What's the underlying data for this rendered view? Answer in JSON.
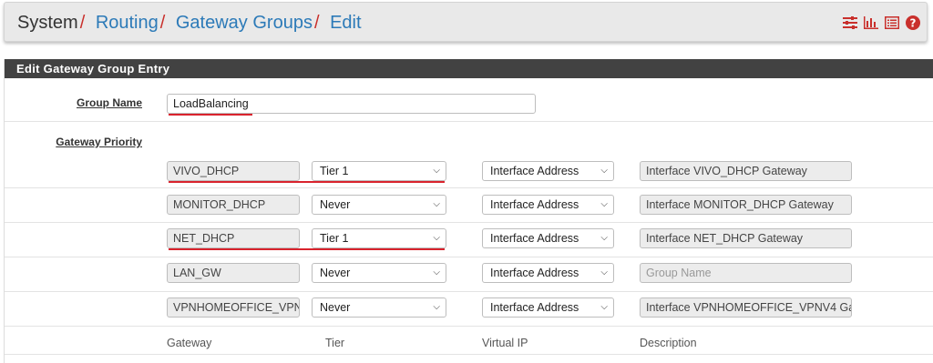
{
  "breadcrumb": {
    "root": "System",
    "items": [
      "Routing",
      "Gateway Groups",
      "Edit"
    ],
    "separator": "/"
  },
  "toolbar": {
    "icons": [
      "sliders-icon",
      "bar-chart-icon",
      "list-icon",
      "help-icon"
    ],
    "icon_color": "#c9302c"
  },
  "panel": {
    "title": "Edit Gateway Group Entry",
    "group_name_label": "Group Name",
    "group_name_value": "LoadBalancing",
    "priority_label": "Gateway Priority"
  },
  "gateways": [
    {
      "gateway": "VIVO_DHCP",
      "tier": "Tier 1",
      "vip": "Interface Address",
      "description": "Interface VIVO_DHCP Gateway",
      "desc_placeholder": false
    },
    {
      "gateway": "MONITOR_DHCP",
      "tier": "Never",
      "vip": "Interface Address",
      "description": "Interface MONITOR_DHCP Gateway",
      "desc_placeholder": false
    },
    {
      "gateway": "NET_DHCP",
      "tier": "Tier 1",
      "vip": "Interface Address",
      "description": "Interface NET_DHCP Gateway",
      "desc_placeholder": false
    },
    {
      "gateway": "LAN_GW",
      "tier": "Never",
      "vip": "Interface Address",
      "description": "Group Name",
      "desc_placeholder": true
    },
    {
      "gateway": "VPNHOMEOFFICE_VPN'",
      "tier": "Never",
      "vip": "Interface Address",
      "description": "Interface VPNHOMEOFFICE_VPNV4 Gat",
      "desc_placeholder": false
    }
  ],
  "columns": {
    "gateway": "Gateway",
    "tier": "Tier",
    "vip": "Virtual IP",
    "description": "Description"
  },
  "colors": {
    "accent_red": "#d9232d",
    "link_blue": "#2c7ab8",
    "header_dark": "#424242"
  }
}
